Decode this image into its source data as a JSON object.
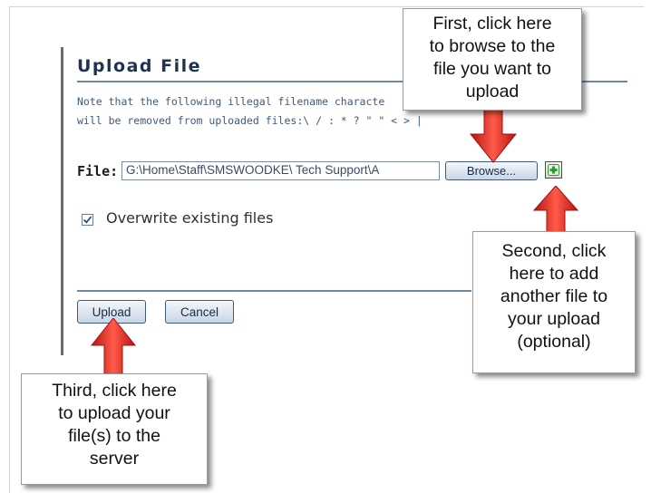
{
  "upload_form": {
    "title": "Upload File",
    "note_line1": "Note that the following illegal filename characte",
    "note_line2": "will be removed from uploaded files:\\ / : * ? \" \" < > |",
    "file_label": "File:",
    "file_value": "G:\\Home\\Staff\\SMSWOODKE\\ Tech Support\\A",
    "browse_label": "Browse...",
    "add_file_icon": "green-plus-icon",
    "overwrite_checked": true,
    "overwrite_label": "Overwrite existing files",
    "upload_label": "Upload",
    "cancel_label": "Cancel"
  },
  "callouts": {
    "first": "First, click here\nto browse to the\nfile you want to\nupload",
    "second": "Second, click\nhere to add\nanother file to\nyour upload\n(optional)",
    "third": "Third, click here\nto upload your\nfile(s) to the\nserver"
  },
  "colors": {
    "title": "#1f3350",
    "note_text": "#3e5a80",
    "rule": "#6d87a6",
    "arrow_red": "#e8221c",
    "add_icon_green": "#2f9a2f"
  }
}
